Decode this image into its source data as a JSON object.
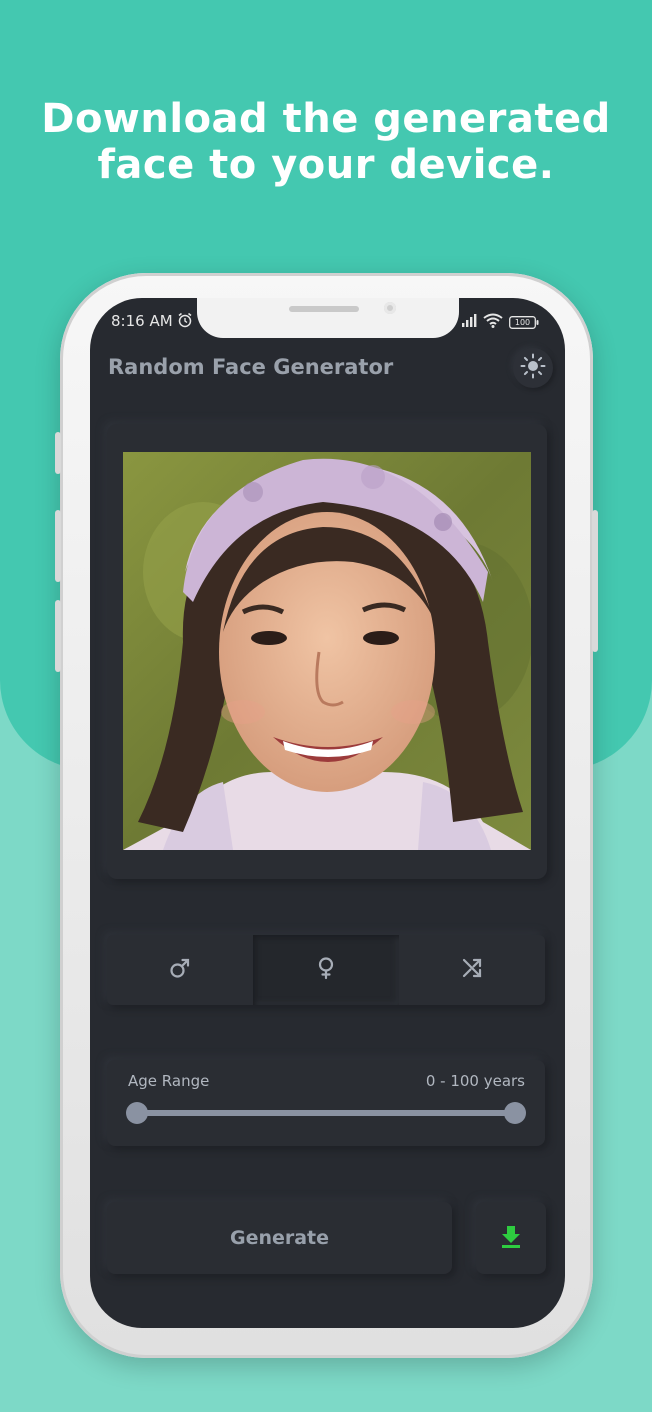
{
  "headline": {
    "line1": "Download the generated",
    "line2": "face to your device."
  },
  "status_bar": {
    "time": "8:16 AM",
    "battery": "100"
  },
  "app": {
    "title": "Random Face Generator"
  },
  "gender_options": [
    {
      "icon": "male-icon",
      "selected": false
    },
    {
      "icon": "female-icon",
      "selected": true
    },
    {
      "icon": "shuffle-icon",
      "selected": false
    }
  ],
  "age_range": {
    "label": "Age Range",
    "value_text": "0 - 100 years",
    "min": 0,
    "max": 100
  },
  "actions": {
    "generate_label": "Generate"
  },
  "colors": {
    "background_top": "#44c8b0",
    "background_bottom": "#7dd9c7",
    "screen": "#272a30",
    "download_accent": "#2ecc40"
  }
}
